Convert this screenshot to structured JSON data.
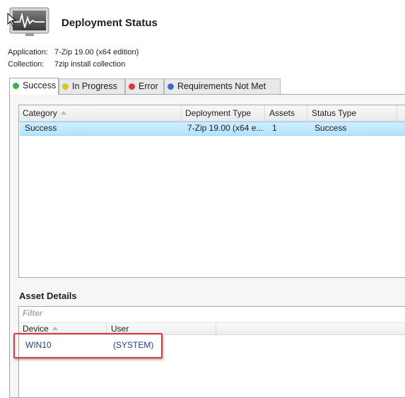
{
  "header": {
    "title": "Deployment Status",
    "icon": "monitor-chart-icon"
  },
  "info": {
    "application_label": "Application:",
    "application_value": "7-Zip 19.00 (x64 edition)",
    "collection_label": "Collection:",
    "collection_value": "7zip install collection"
  },
  "tabs": [
    {
      "label": "Success",
      "color": "#3bb34a"
    },
    {
      "label": "In Progress",
      "color": "#d8c42a"
    },
    {
      "label": "Error",
      "color": "#d73b3b"
    },
    {
      "label": "Requirements Not Met",
      "color": "#3f6fc4"
    }
  ],
  "grid": {
    "columns": [
      "Category",
      "Deployment Type",
      "Assets",
      "Status Type"
    ],
    "rows": [
      {
        "category": "Success",
        "deployment_type": "7-Zip 19.00 (x64 e...",
        "assets": "1",
        "status_type": "Success"
      }
    ]
  },
  "asset_details": {
    "title": "Asset Details",
    "filter_placeholder": "Filter",
    "columns": [
      "Device",
      "User"
    ],
    "rows": [
      {
        "device": "WIN10",
        "user": "(SYSTEM)"
      }
    ]
  },
  "colors": {
    "selection": "#b4e3fb",
    "highlight_box": "#e3383d",
    "link_text": "#1b3d8f"
  }
}
